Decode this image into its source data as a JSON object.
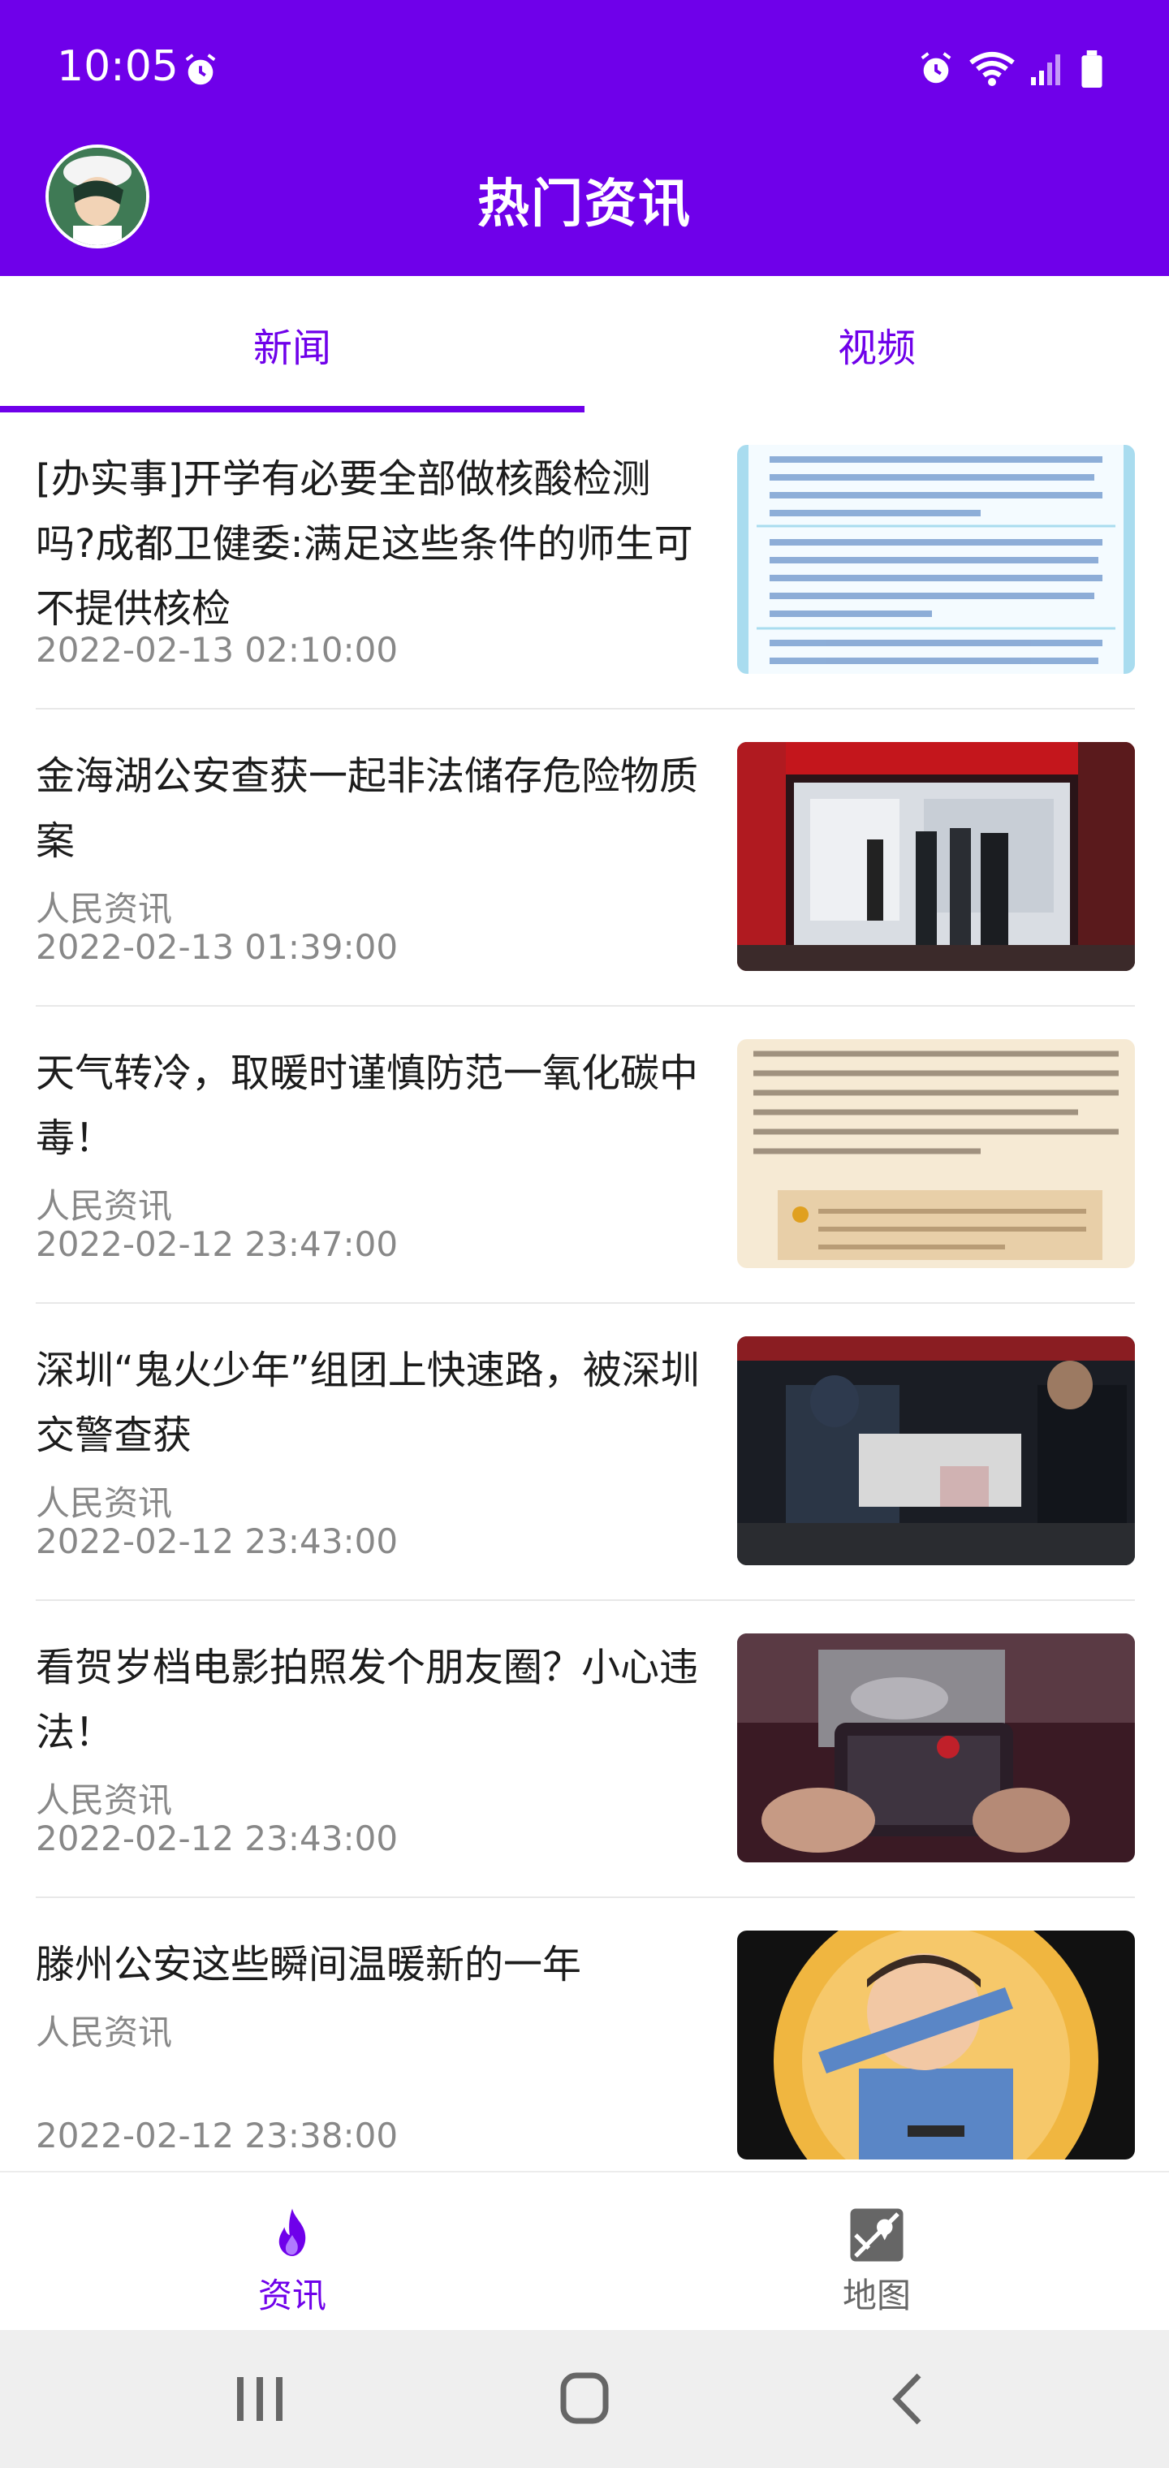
{
  "status_bar": {
    "time": "10:05"
  },
  "app_bar": {
    "title": "热门资讯"
  },
  "tabs": [
    {
      "label": "新闻",
      "selected": true
    },
    {
      "label": "视频",
      "selected": false
    }
  ],
  "news": [
    {
      "title": "[办实事]开学有必要全部做核酸检测吗?成都卫健委:满足这些条件的师生可不提供核检",
      "source": "",
      "date": "2022-02-13 02:10:00"
    },
    {
      "title": "金海湖公安查获一起非法储存危险物质案",
      "source": "人民资讯",
      "date": "2022-02-13 01:39:00"
    },
    {
      "title": "天气转冷，取暖时谨慎防范一氧化碳中毒！",
      "source": "人民资讯",
      "date": "2022-02-12 23:47:00"
    },
    {
      "title": "深圳“鬼火少年”组团上快速路，被深圳交警查获",
      "source": "人民资讯",
      "date": "2022-02-12 23:43:00"
    },
    {
      "title": "看贺岁档电影拍照发个朋友圈？小心违法！",
      "source": "人民资讯",
      "date": "2022-02-12 23:43:00"
    },
    {
      "title": "滕州公安这些瞬间温暖新的一年",
      "source": "人民资讯",
      "date": "2022-02-12 23:38:00"
    }
  ],
  "bottom_nav": [
    {
      "label": "资讯",
      "icon": "flame-icon",
      "active": true
    },
    {
      "label": "地图",
      "icon": "map-icon",
      "active": false
    }
  ],
  "colors": {
    "primary": "#6f00ea",
    "text": "#1c1c1c",
    "muted": "#888888",
    "inactive": "#666666"
  }
}
